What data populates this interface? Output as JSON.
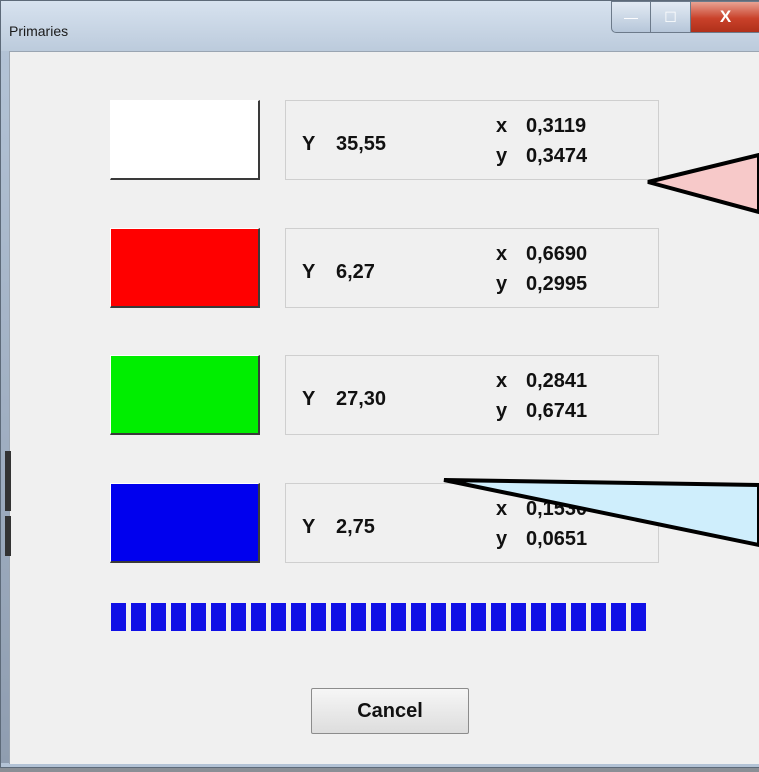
{
  "window": {
    "title": "Primaries"
  },
  "caption": {
    "min_glyph": "—",
    "max_glyph": "☐",
    "close_glyph": "X"
  },
  "primaries": [
    {
      "name": "white",
      "color": "#ffffff",
      "Y_label": "Y",
      "Y": "35,55",
      "x_label": "x",
      "x": "0,3119",
      "y_label": "y",
      "y": "0,3474"
    },
    {
      "name": "red",
      "color": "#ff0000",
      "Y_label": "Y",
      "Y": "6,27",
      "x_label": "x",
      "x": "0,6690",
      "y_label": "y",
      "y": "0,2995"
    },
    {
      "name": "green",
      "color": "#00ee00",
      "Y_label": "Y",
      "Y": "27,30",
      "x_label": "x",
      "x": "0,2841",
      "y_label": "y",
      "y": "0,6741"
    },
    {
      "name": "blue",
      "color": "#0000ee",
      "Y_label": "Y",
      "Y": "2,75",
      "x_label": "x",
      "x": "0,1530",
      "y_label": "y",
      "y": "0,0651"
    }
  ],
  "progress": {
    "value": 1.0,
    "color": "#1010e6"
  },
  "buttons": {
    "cancel_label": "Cancel"
  },
  "callouts": {
    "top_color": "#f7c9c9",
    "bottom_color": "#cfeefc"
  }
}
